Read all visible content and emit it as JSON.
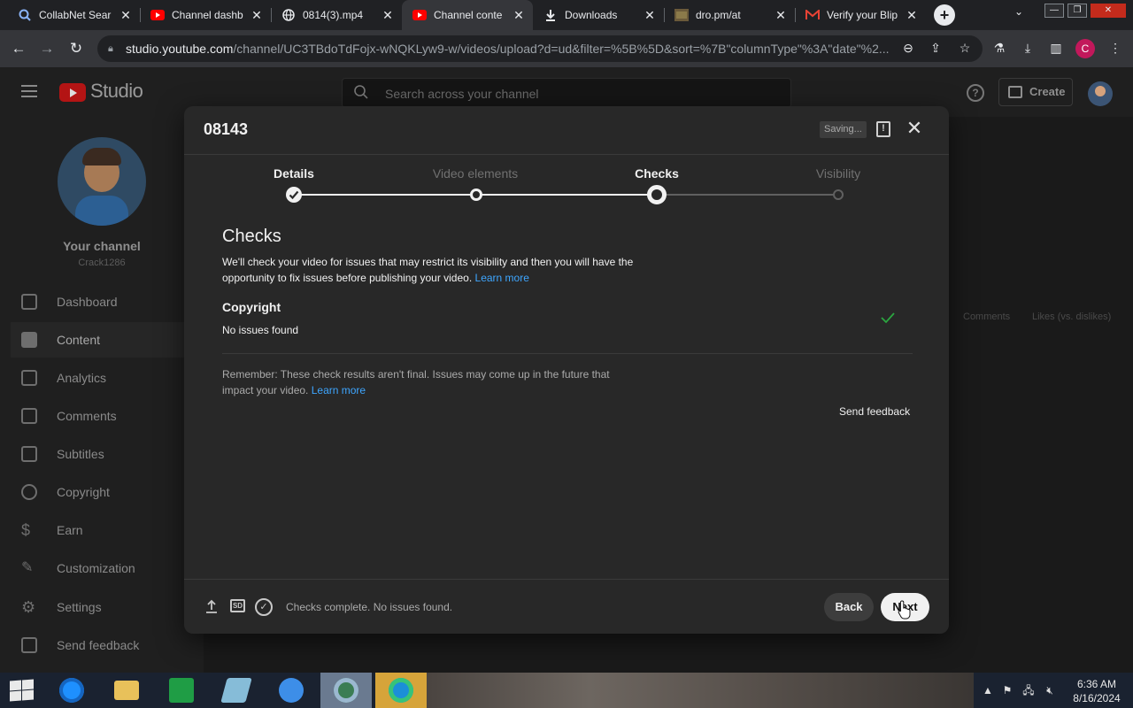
{
  "browser": {
    "tabs": [
      {
        "title": "CollabNet Sear",
        "icon": "search-icon"
      },
      {
        "title": "Channel dashb",
        "icon": "youtube-icon"
      },
      {
        "title": "0814(3).mp4",
        "icon": "globe-icon"
      },
      {
        "title": "Channel conte",
        "icon": "youtube-icon"
      },
      {
        "title": "Downloads",
        "icon": "download-icon"
      },
      {
        "title": "dro.pm/at",
        "icon": "image-icon"
      },
      {
        "title": "Verify your Blip",
        "icon": "gmail-icon"
      }
    ],
    "url_host": "studio.youtube.com",
    "url_path": "/channel/UC3TBdoTdFojx-wNQKLyw9-w/videos/upload?d=ud&filter=%5B%5D&sort=%7B\"columnType\"%3A\"date\"%2...",
    "profile_initial": "C"
  },
  "studio": {
    "logo_text": "Studio",
    "search_placeholder": "Search across your channel",
    "create_label": "Create",
    "channel_title": "Your channel",
    "channel_handle": "Crack1286",
    "nav": [
      {
        "label": "Dashboard",
        "icon": "dashboard-icon"
      },
      {
        "label": "Content",
        "icon": "content-icon"
      },
      {
        "label": "Analytics",
        "icon": "analytics-icon"
      },
      {
        "label": "Comments",
        "icon": "comments-icon"
      },
      {
        "label": "Subtitles",
        "icon": "subtitles-icon"
      },
      {
        "label": "Copyright",
        "icon": "copyright-icon"
      },
      {
        "label": "Earn",
        "icon": "earn-icon"
      },
      {
        "label": "Customization",
        "icon": "customization-icon"
      },
      {
        "label": "Settings",
        "icon": "gear-icon"
      },
      {
        "label": "Send feedback",
        "icon": "feedback-icon"
      }
    ],
    "columns": [
      "Comments",
      "Likes (vs. dislikes)"
    ]
  },
  "dialog": {
    "title": "08143",
    "saving": "Saving...",
    "steps": [
      "Details",
      "Video elements",
      "Checks",
      "Visibility"
    ],
    "current_step": "Checks",
    "section_title": "Checks",
    "section_desc": "We'll check your video for issues that may restrict its visibility and then you will have the opportunity to fix issues before publishing your video.",
    "learn_more": "Learn more",
    "copyright_title": "Copyright",
    "copyright_status": "No issues found",
    "remember_text": "Remember: These check results aren't final. Issues may come up in the future that impact your video.",
    "send_feedback": "Send feedback",
    "footer_status": "Checks complete. No issues found.",
    "sd_badge": "SD",
    "back_label": "Back",
    "next_label": "Next"
  },
  "taskbar": {
    "time": "6:36 AM",
    "date": "8/16/2024"
  },
  "colors": {
    "accent_link": "#3ea6ff",
    "youtube_red": "#ff0000",
    "check_green": "#2ba640"
  }
}
